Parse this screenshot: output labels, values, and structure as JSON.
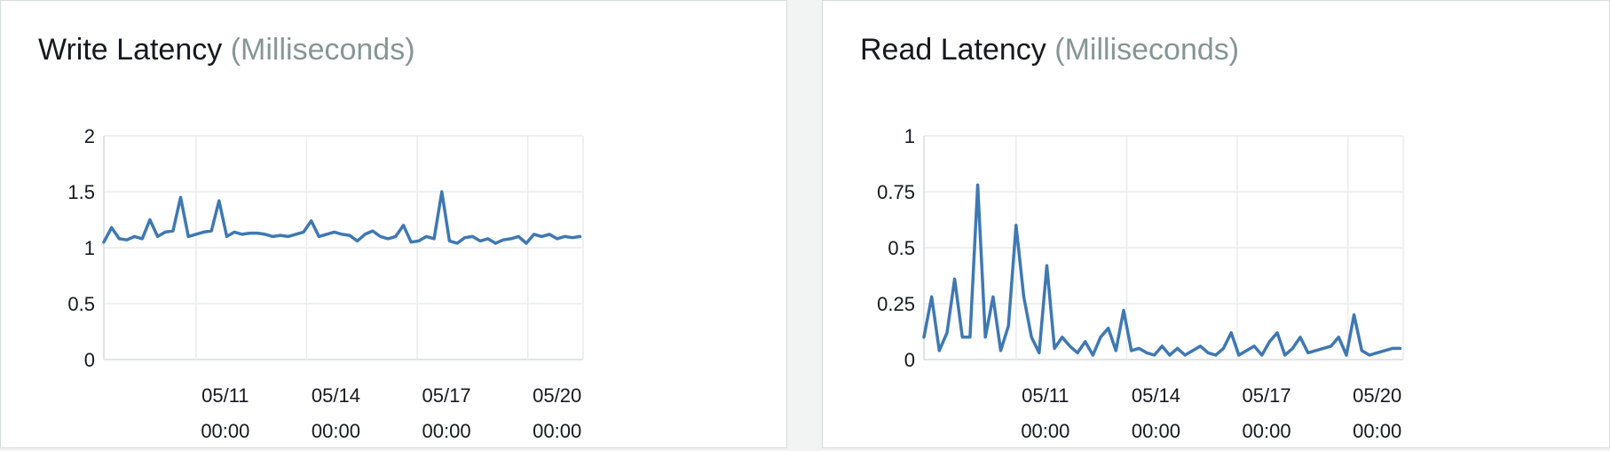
{
  "colors": {
    "series": "#3f78b3",
    "grid": "#e9ebed",
    "axis": "#d5dbdb",
    "text": "#16191f",
    "unit_text": "#879596",
    "background": "#f2f3f3"
  },
  "panels": [
    {
      "title": "Write Latency",
      "unit": "(Milliseconds)"
    },
    {
      "title": "Read Latency",
      "unit": "(Milliseconds)"
    }
  ],
  "chart_data": [
    {
      "type": "line",
      "title": "Write Latency (Milliseconds)",
      "xlabel": "",
      "ylabel": "",
      "x_range": [
        "05/08 12:00",
        "05/21 12:00"
      ],
      "ylim": [
        0,
        2
      ],
      "y_ticks": [
        "0",
        "0.5",
        "1",
        "1.5",
        "2"
      ],
      "x_ticks": [
        {
          "date": "05/11",
          "time": "00:00"
        },
        {
          "date": "05/14",
          "time": "00:00"
        },
        {
          "date": "05/17",
          "time": "00:00"
        },
        {
          "date": "05/20",
          "time": "00:00"
        }
      ],
      "grid": true,
      "series": [
        {
          "x": [
            "05/08 12:00",
            "05/08 17:00",
            "05/08 22:00",
            "05/09 03:00",
            "05/09 08:00",
            "05/09 13:00",
            "05/09 18:00",
            "05/09 23:00",
            "05/10 04:00",
            "05/10 09:00",
            "05/10 14:00",
            "05/10 19:00",
            "05/11 00:00",
            "05/11 05:00",
            "05/11 10:00",
            "05/11 15:00",
            "05/11 20:00",
            "05/12 01:00",
            "05/12 06:00",
            "05/12 11:00",
            "05/12 16:00",
            "05/12 21:00",
            "05/13 02:00",
            "05/13 07:00",
            "05/13 12:00",
            "05/13 17:00",
            "05/13 22:00",
            "05/14 03:00",
            "05/14 08:00",
            "05/14 13:00",
            "05/14 18:00",
            "05/14 23:00",
            "05/15 04:00",
            "05/15 09:00",
            "05/15 14:00",
            "05/15 19:00",
            "05/16 00:00",
            "05/16 05:00",
            "05/16 10:00",
            "05/16 15:00",
            "05/16 20:00",
            "05/17 01:00",
            "05/17 06:00",
            "05/17 11:00",
            "05/17 16:00",
            "05/17 21:00",
            "05/18 02:00",
            "05/18 07:00",
            "05/18 12:00",
            "05/18 17:00",
            "05/18 22:00",
            "05/19 03:00",
            "05/19 08:00",
            "05/19 13:00",
            "05/19 18:00",
            "05/19 23:00",
            "05/20 04:00",
            "05/20 09:00",
            "05/20 14:00",
            "05/20 19:00",
            "05/21 00:00",
            "05/21 05:00",
            "05/21 10:00"
          ],
          "values": [
            1.05,
            1.18,
            1.08,
            1.07,
            1.1,
            1.08,
            1.25,
            1.1,
            1.14,
            1.15,
            1.45,
            1.1,
            1.12,
            1.14,
            1.15,
            1.42,
            1.1,
            1.14,
            1.12,
            1.13,
            1.13,
            1.12,
            1.1,
            1.11,
            1.1,
            1.12,
            1.14,
            1.24,
            1.1,
            1.12,
            1.14,
            1.12,
            1.11,
            1.06,
            1.12,
            1.15,
            1.1,
            1.08,
            1.1,
            1.2,
            1.05,
            1.06,
            1.1,
            1.08,
            1.5,
            1.06,
            1.04,
            1.09,
            1.1,
            1.06,
            1.08,
            1.04,
            1.07,
            1.08,
            1.1,
            1.04,
            1.12,
            1.1,
            1.12,
            1.08,
            1.1,
            1.09,
            1.1
          ]
        }
      ]
    },
    {
      "type": "line",
      "title": "Read Latency (Milliseconds)",
      "xlabel": "",
      "ylabel": "",
      "x_range": [
        "05/08 12:00",
        "05/21 12:00"
      ],
      "ylim": [
        0,
        1
      ],
      "y_ticks": [
        "0",
        "0.25",
        "0.5",
        "0.75",
        "1"
      ],
      "x_ticks": [
        {
          "date": "05/11",
          "time": "00:00"
        },
        {
          "date": "05/14",
          "time": "00:00"
        },
        {
          "date": "05/17",
          "time": "00:00"
        },
        {
          "date": "05/20",
          "time": "00:00"
        }
      ],
      "grid": true,
      "series": [
        {
          "x": [
            "05/08 12:00",
            "05/08 17:00",
            "05/08 22:00",
            "05/09 03:00",
            "05/09 08:00",
            "05/09 13:00",
            "05/09 18:00",
            "05/09 23:00",
            "05/10 04:00",
            "05/10 09:00",
            "05/10 14:00",
            "05/10 19:00",
            "05/11 00:00",
            "05/11 05:00",
            "05/11 10:00",
            "05/11 15:00",
            "05/11 20:00",
            "05/12 01:00",
            "05/12 06:00",
            "05/12 11:00",
            "05/12 16:00",
            "05/12 21:00",
            "05/13 02:00",
            "05/13 07:00",
            "05/13 12:00",
            "05/13 17:00",
            "05/13 22:00",
            "05/14 03:00",
            "05/14 08:00",
            "05/14 13:00",
            "05/14 18:00",
            "05/14 23:00",
            "05/15 04:00",
            "05/15 09:00",
            "05/15 14:00",
            "05/15 19:00",
            "05/16 00:00",
            "05/16 05:00",
            "05/16 10:00",
            "05/16 15:00",
            "05/16 20:00",
            "05/17 01:00",
            "05/17 06:00",
            "05/17 11:00",
            "05/17 16:00",
            "05/17 21:00",
            "05/18 02:00",
            "05/18 07:00",
            "05/18 12:00",
            "05/18 17:00",
            "05/18 22:00",
            "05/19 03:00",
            "05/19 08:00",
            "05/19 13:00",
            "05/19 18:00",
            "05/19 23:00",
            "05/20 04:00",
            "05/20 09:00",
            "05/20 14:00",
            "05/20 19:00",
            "05/21 00:00",
            "05/21 05:00",
            "05/21 10:00"
          ],
          "values": [
            0.1,
            0.28,
            0.04,
            0.12,
            0.36,
            0.1,
            0.1,
            0.78,
            0.1,
            0.28,
            0.04,
            0.15,
            0.6,
            0.28,
            0.1,
            0.03,
            0.42,
            0.05,
            0.1,
            0.06,
            0.03,
            0.08,
            0.02,
            0.1,
            0.14,
            0.04,
            0.22,
            0.04,
            0.05,
            0.03,
            0.02,
            0.06,
            0.02,
            0.05,
            0.02,
            0.04,
            0.06,
            0.03,
            0.02,
            0.05,
            0.12,
            0.02,
            0.04,
            0.06,
            0.02,
            0.08,
            0.12,
            0.02,
            0.05,
            0.1,
            0.03,
            0.04,
            0.05,
            0.06,
            0.1,
            0.02,
            0.2,
            0.04,
            0.02,
            0.03,
            0.04,
            0.05,
            0.05
          ]
        }
      ]
    }
  ]
}
